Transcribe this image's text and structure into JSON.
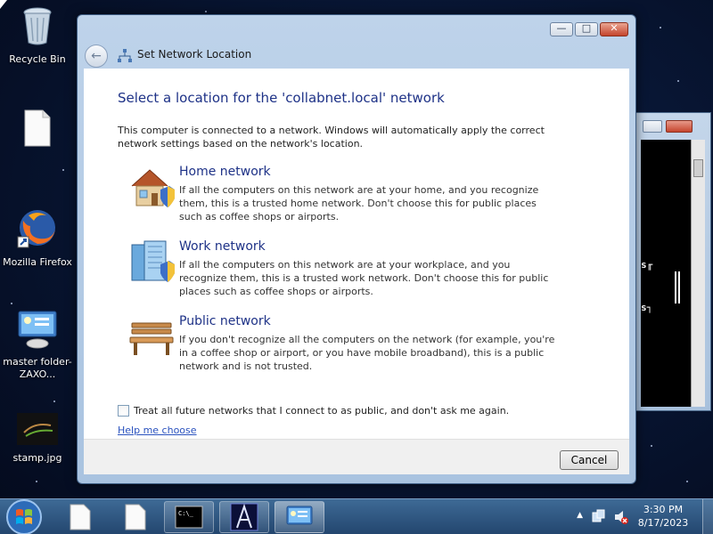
{
  "desktop": {
    "icons": [
      {
        "label": "Recycle Bin",
        "icon": "recycle-bin-icon"
      },
      {
        "label": "",
        "icon": "blank-file-icon"
      },
      {
        "label": "Mozilla Firefox",
        "icon": "firefox-icon"
      },
      {
        "label": "master folder-ZAXO...",
        "icon": "network-settings-icon"
      },
      {
        "label": "stamp.jpg",
        "icon": "image-file-icon"
      }
    ]
  },
  "console": {
    "line1": "s╓",
    "line2": "s┐"
  },
  "dialog": {
    "title": "Set Network Location",
    "heading": "Select a location for the 'collabnet.local' network",
    "intro": "This computer is connected to a network. Windows will automatically apply the correct network settings based on the network's location.",
    "options": [
      {
        "title": "Home network",
        "description": "If all the computers on this network are at your home, and you recognize them, this is a trusted home network.  Don't choose this for public places such as coffee shops or airports.",
        "icon": "home-network-icon"
      },
      {
        "title": "Work network",
        "description": "If all the computers on this network are at your workplace, and you recognize them, this is a trusted work network.  Don't choose this for public places such as coffee shops or airports.",
        "icon": "work-network-icon"
      },
      {
        "title": "Public network",
        "description": "If you don't recognize all the computers on the network (for example, you're in a coffee shop or airport, or you have mobile broadband), this is a public network and is not trusted.",
        "icon": "public-network-icon"
      }
    ],
    "checkbox_label": "Treat all future networks that I connect to as public, and don't ask me again.",
    "checkbox_checked": false,
    "help_link": "Help me choose",
    "cancel_label": "Cancel",
    "controls": {
      "minimize": "—",
      "maximize": "□",
      "close": "✕"
    }
  },
  "taskbar": {
    "time": "3:30 PM",
    "date": "8/17/2023",
    "tray_arrow": "▲",
    "items": [
      "start-orb",
      "file-icon",
      "file-icon",
      "console-icon",
      "font-app-icon",
      "network-settings-icon"
    ]
  },
  "colors": {
    "heading": "#1e3287",
    "link": "#2a52be",
    "taskbar": "#2b5179"
  }
}
